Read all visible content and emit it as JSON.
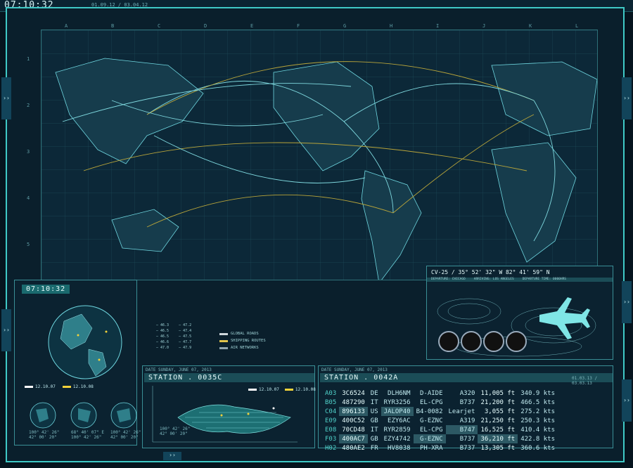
{
  "top": {
    "clock": "07:10:32",
    "dates": "01.09.12 / 03.04.12"
  },
  "map": {
    "columns": [
      "A",
      "B",
      "C",
      "D",
      "E",
      "F",
      "G",
      "H",
      "I",
      "J",
      "K",
      "L"
    ],
    "rows": [
      "1",
      "2",
      "3",
      "4",
      "5"
    ],
    "legend_values_left": [
      "46.3",
      "46.5",
      "46.5",
      "46.6",
      "47.0"
    ],
    "legend_values_right": [
      "47.2",
      "47.4",
      "47.5",
      "47.7",
      "47.9"
    ],
    "legend": [
      {
        "label": "GLOBAL ROADS",
        "color": "#cfd8dc"
      },
      {
        "label": "SHIPPING ROUTES",
        "color": "#e0c24a"
      },
      {
        "label": "AIR NETWORKS",
        "color": "#8fa3ad"
      }
    ]
  },
  "globe_panel": {
    "clock": "07:10:32",
    "legend": [
      {
        "label": "12.10.07",
        "color": "#ffffff"
      },
      {
        "label": "12.10.08",
        "color": "#f2d23a"
      }
    ],
    "small_globes": [
      {
        "coords": "100° 42' 26\"\n42° 00' 20\""
      },
      {
        "coords": "68° 40' 07\" E\n100° 42' 26\""
      },
      {
        "coords": "100° 42' 26\"\n42° 00' 20\""
      }
    ]
  },
  "station_left": {
    "date": "DATE  SUNDAY, JUNE 07, 2013",
    "title": "STATION . 0035C",
    "legend": [
      {
        "label": "12.10.07",
        "color": "#ffffff"
      },
      {
        "label": "12.10.08",
        "color": "#f2d23a"
      }
    ],
    "coords": "100° 42' 26\"\n42° 00' 20\""
  },
  "station_right": {
    "date": "DATE  SUNDAY, JUNE 07, 2013",
    "title": "STATION . 0042A",
    "timestamp": "01.03.13 / 03.03.13",
    "rows": [
      {
        "code": "A03",
        "id": "3C6524",
        "country": "DE",
        "reg": "DLH6NM",
        "airline": "D-AIDE",
        "type": "A320",
        "alt": "11,005 ft",
        "spd": "340.9 kts",
        "hl": []
      },
      {
        "code": "B05",
        "id": "487290",
        "country": "IT",
        "reg": "RYR3256",
        "airline": "EL-CPG",
        "type": "B737",
        "alt": "21,200 ft",
        "spd": "466.5 kts",
        "hl": []
      },
      {
        "code": "C04",
        "id": "896133",
        "country": "US",
        "reg": "JALOP40",
        "airline": "B4-0082",
        "type": "Learjet",
        "alt": "3,055 ft",
        "spd": "275.2 kts",
        "hl": [
          "id",
          "reg"
        ]
      },
      {
        "code": "E09",
        "id": "400C52",
        "country": "GB",
        "reg": "EZY6AC",
        "airline": "G-EZNC",
        "type": "A319",
        "alt": "21,250 ft",
        "spd": "250.3 kts",
        "hl": []
      },
      {
        "code": "E08",
        "id": "70CD48",
        "country": "IT",
        "reg": "RYR2859",
        "airline": "EL-CPG",
        "type": "B747",
        "alt": "16,525 ft",
        "spd": "410.4 kts",
        "hl": [
          "type"
        ]
      },
      {
        "code": "F03",
        "id": "400AC7",
        "country": "GB",
        "reg": "EZY4742",
        "airline": "G-EZNC",
        "type": "B737",
        "alt": "36,210 ft",
        "spd": "422.8 kts",
        "hl": [
          "id",
          "airline",
          "alt"
        ]
      },
      {
        "code": "H02",
        "id": "480AE2",
        "country": "FR",
        "reg": "HV8038",
        "airline": "PH-XRA",
        "type": "B737",
        "alt": "13,305 ft",
        "spd": "360.6 kts",
        "hl": []
      }
    ]
  },
  "flight_panel": {
    "header": "CV-25  /  35° 52' 32\" W    82° 41' 59\" N",
    "sub": [
      "DEPARTURE: CHICAGO",
      "ARRIVING: LOS ANGELES",
      "DEPARTURE TIME: 0000HRS"
    ]
  },
  "tabs": {
    "arrow": "››"
  }
}
